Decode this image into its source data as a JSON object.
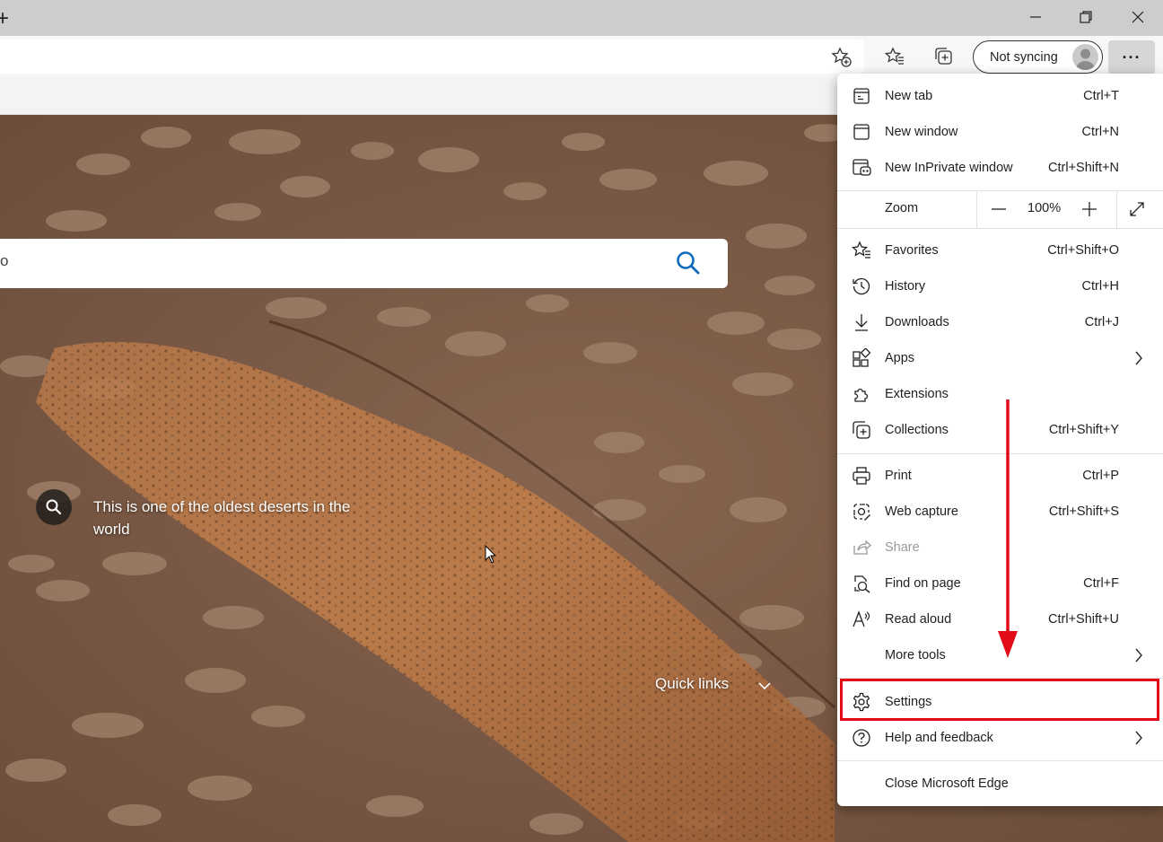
{
  "window": {
    "new_tab_glyph": "+",
    "controls": [
      "minimize-icon",
      "restore-icon",
      "close-icon"
    ]
  },
  "toolbar": {
    "icons": [
      "add-favorite-icon",
      "favorites-icon",
      "collections-icon"
    ],
    "sync_label": "Not syncing",
    "more_label": "···"
  },
  "page": {
    "search_glyph": "o",
    "caption": "This is one of the oldest deserts in the world",
    "quick_links": "Quick links"
  },
  "menu": {
    "items": [
      {
        "label": "New tab",
        "shortcut": "Ctrl+T",
        "icon": "new-tab-icon"
      },
      {
        "label": "New window",
        "shortcut": "Ctrl+N",
        "icon": "new-window-icon"
      },
      {
        "label": "New InPrivate window",
        "shortcut": "Ctrl+Shift+N",
        "icon": "inprivate-icon"
      },
      {
        "label": "Favorites",
        "shortcut": "Ctrl+Shift+O",
        "icon": "favorites-icon"
      },
      {
        "label": "History",
        "shortcut": "Ctrl+H",
        "icon": "history-icon"
      },
      {
        "label": "Downloads",
        "shortcut": "Ctrl+J",
        "icon": "download-icon"
      },
      {
        "label": "Apps",
        "shortcut": "",
        "icon": "apps-icon"
      },
      {
        "label": "Extensions",
        "shortcut": "",
        "icon": "extensions-icon"
      },
      {
        "label": "Collections",
        "shortcut": "Ctrl+Shift+Y",
        "icon": "collections-icon"
      },
      {
        "label": "Print",
        "shortcut": "Ctrl+P",
        "icon": "print-icon"
      },
      {
        "label": "Web capture",
        "shortcut": "Ctrl+Shift+S",
        "icon": "web-capture-icon"
      },
      {
        "label": "Share",
        "shortcut": "",
        "icon": "share-icon"
      },
      {
        "label": "Find on page",
        "shortcut": "Ctrl+F",
        "icon": "find-icon"
      },
      {
        "label": "Read aloud",
        "shortcut": "Ctrl+Shift+U",
        "icon": "read-aloud-icon"
      },
      {
        "label": "More tools",
        "shortcut": "",
        "icon": ""
      },
      {
        "label": "Settings",
        "shortcut": "",
        "icon": "settings-icon"
      },
      {
        "label": "Help and feedback",
        "shortcut": "",
        "icon": "help-icon"
      },
      {
        "label": "Close Microsoft Edge",
        "shortcut": "",
        "icon": ""
      }
    ],
    "zoom": {
      "label": "Zoom",
      "value": "100%"
    }
  },
  "colors": {
    "highlight": "#e30b17",
    "accent_blue": "#0f6cbd",
    "desert": "#7a5a42"
  }
}
